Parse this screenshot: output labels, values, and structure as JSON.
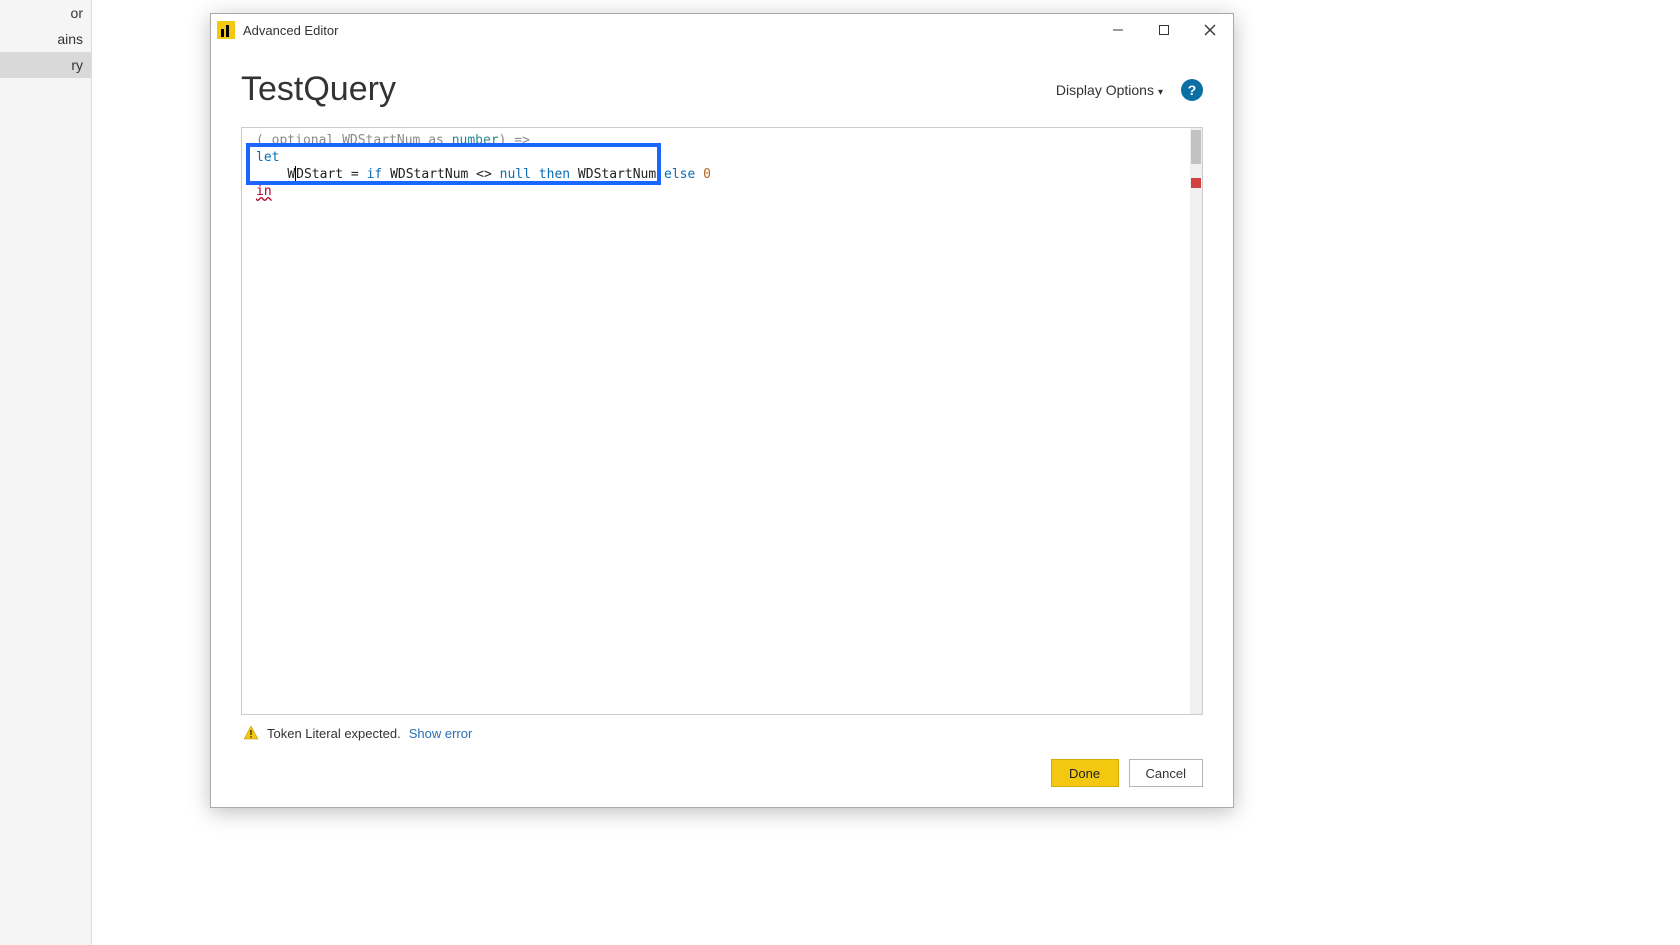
{
  "background": {
    "items": [
      "or",
      "ains",
      "ry"
    ],
    "selected_index": 2
  },
  "dialog": {
    "title": "Advanced Editor",
    "query_name": "TestQuery",
    "display_options_label": "Display Options",
    "help_tooltip": "?",
    "code": {
      "line1": {
        "prefix": "( ",
        "kw_optional": "optional",
        "param": " WDStartNum ",
        "kw_as": "as",
        "sp": " ",
        "type": "number",
        "suffix": ") =>"
      },
      "line2": {
        "kw_let": "let"
      },
      "line3": {
        "indent": "    ",
        "lhs_a": "W",
        "lhs_b": "DStart = ",
        "kw_if": "if",
        "mid1": " WDStartNum <> ",
        "kw_null": "null",
        "sp1": " ",
        "kw_then": "then",
        "mid2": " WDStartNum ",
        "kw_else": "else",
        "sp2": " ",
        "zero": "0"
      },
      "line4": {
        "kw_in": "in"
      }
    },
    "status": {
      "message": "Token Literal expected.",
      "show_error": "Show error"
    },
    "buttons": {
      "done": "Done",
      "cancel": "Cancel"
    }
  }
}
